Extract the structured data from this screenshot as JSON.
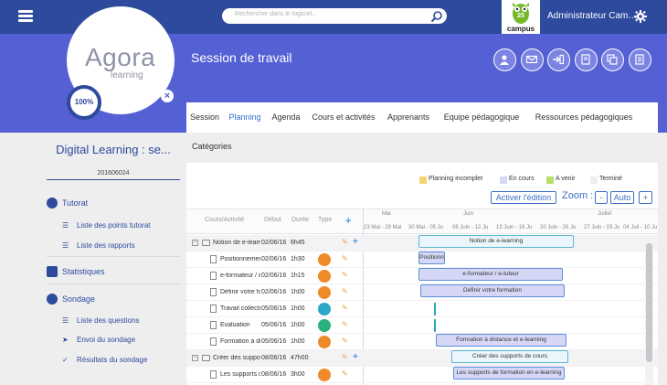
{
  "topbar": {
    "search_placeholder": "Rechercher dans le logiciel...",
    "campus_badge_number": "25",
    "campus_label": "campus",
    "admin_label": "Administrateur Cam…"
  },
  "logo": {
    "name": "Agora",
    "sub": "learning"
  },
  "header": {
    "title": "Session de travail",
    "progress": "100%",
    "close_label": "×"
  },
  "tabs": [
    {
      "label": "Session",
      "active": false
    },
    {
      "label": "Planning",
      "active": true
    },
    {
      "label": "Agenda",
      "active": false
    },
    {
      "label": "Cours et activités",
      "active": false
    },
    {
      "label": "Apprenants",
      "active": false
    },
    {
      "label": "Equipe pédagogique",
      "active": false
    },
    {
      "label": "Ressources pédagogiques",
      "active": false
    }
  ],
  "categories_label": "Catégories",
  "sidebar": {
    "title": "Digital Learning : se...",
    "subtitle": "201606024",
    "sections": [
      {
        "label": "Tutorat",
        "items": [
          "Liste des points tutorat",
          "Liste des rapports"
        ]
      },
      {
        "label": "Statistiques",
        "items": []
      },
      {
        "label": "Sondage",
        "items": [
          "Liste des questions",
          "Envoi du sondage",
          "Résultats du sondage"
        ]
      }
    ]
  },
  "legend": [
    {
      "label": "Planning incomplet",
      "color": "#f3d46e"
    },
    {
      "label": "En cours",
      "color": "#d6d7f7"
    },
    {
      "label": "A venir",
      "color": "#b7e06a"
    },
    {
      "label": "Terminé",
      "color": "#eeeeee"
    }
  ],
  "toolbar": {
    "edit_label": "Activer l'édition",
    "zoom_label": "Zoom :",
    "zoom_minus": "-",
    "zoom_auto": "Auto",
    "zoom_plus": "+"
  },
  "grid": {
    "headers": {
      "course": "Cours/Activité",
      "start": "Début",
      "duration": "Durée",
      "type": "Type",
      "add": "+"
    },
    "months": [
      "Mai",
      "Juin",
      "Juillet"
    ],
    "weeks": [
      "23 Mai - 29 Mai",
      "30 Mai - 05 Ju",
      "06 Juin - 12 Ju",
      "13 Juin - 19 Ju",
      "20 Juin - 26 Ju",
      "27 Juin - 03 Ju",
      "04 Juil - 10 Ju"
    ],
    "rows": [
      {
        "kind": "group",
        "name": "Notion de e-learning",
        "start": "02/06/16",
        "duration": "6h45",
        "bar": "Notion de e-learning",
        "toggle": "−"
      },
      {
        "kind": "task",
        "name": "Positionnement",
        "start": "02/06/16",
        "duration": "1h30",
        "type_color": "#ee8a2a",
        "bar": "Positionn"
      },
      {
        "kind": "task",
        "name": "e-formateur / e-tuteur",
        "start": "02/06/16",
        "duration": "1h15",
        "type_color": "#ee8a2a",
        "bar": "e-formateur / e-tuteur"
      },
      {
        "kind": "task",
        "name": "Définir votre formation",
        "start": "02/06/16",
        "duration": "1h00",
        "type_color": "#ee8a2a",
        "bar": "Définir votre formation"
      },
      {
        "kind": "task",
        "name": "Travail collectif",
        "start": "05/06/16",
        "duration": "1h00",
        "type_color": "#2aa6c7",
        "bar": ""
      },
      {
        "kind": "task",
        "name": "Evaluation",
        "start": "05/06/16",
        "duration": "1h00",
        "type_color": "#2bb07f",
        "bar": ""
      },
      {
        "kind": "task",
        "name": "Formation à distance et e-learning",
        "start": "05/06/16",
        "duration": "1h00",
        "type_color": "#ee8a2a",
        "bar": "Formation à distance et e-learning"
      },
      {
        "kind": "group",
        "name": "Créer des supports de cours",
        "start": "08/06/16",
        "duration": "47h00",
        "bar": "Créer des supports de cours",
        "toggle": "−"
      },
      {
        "kind": "task",
        "name": "Les supports de formation en e-learning",
        "start": "08/06/16",
        "duration": "3h00",
        "type_color": "#ee8a2a",
        "bar": "Les supports de formation en e-learning"
      }
    ]
  }
}
